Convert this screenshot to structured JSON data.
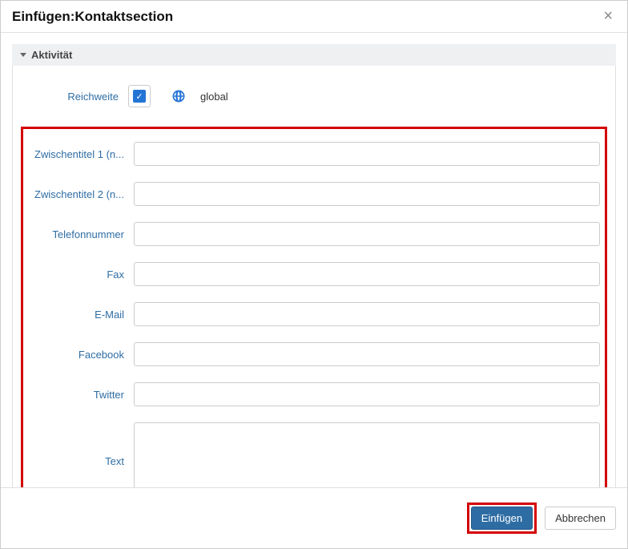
{
  "modal": {
    "title": "Einfügen:Kontaktsection",
    "close": "×"
  },
  "section": {
    "header": "Aktivität"
  },
  "reichweite": {
    "label": "Reichweite",
    "checked": true,
    "value": "global"
  },
  "fields": {
    "zwischentitel1_label": "Zwischentitel 1 (n...",
    "zwischentitel1_value": "",
    "zwischentitel2_label": "Zwischentitel 2 (n...",
    "zwischentitel2_value": "",
    "telefon_label": "Telefonnummer",
    "telefon_value": "",
    "fax_label": "Fax",
    "fax_value": "",
    "email_label": "E-Mail",
    "email_value": "",
    "facebook_label": "Facebook",
    "facebook_value": "",
    "twitter_label": "Twitter",
    "twitter_value": "",
    "text_label": "Text",
    "text_value": ""
  },
  "footer": {
    "primary": "Einfügen",
    "cancel": "Abbrechen"
  }
}
